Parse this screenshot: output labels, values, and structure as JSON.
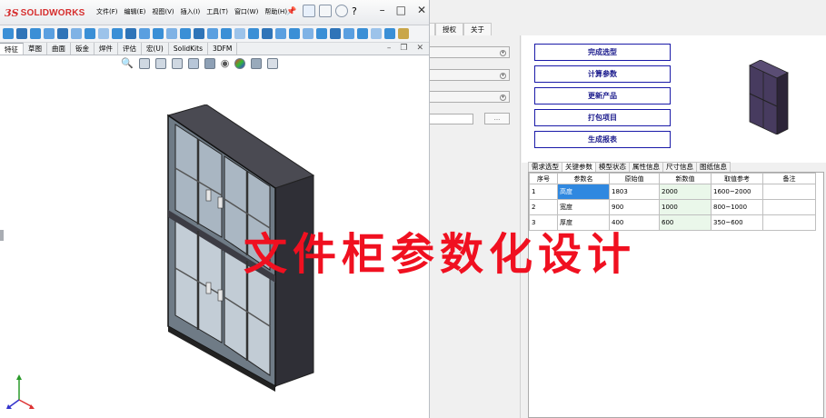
{
  "solidworks": {
    "logo_ds": "3S",
    "logo_text": "SOLIDWORKS",
    "menu": [
      "文件(F)",
      "编辑(E)",
      "视图(V)",
      "插入(I)",
      "工具(T)",
      "窗口(W)",
      "帮助(H)"
    ],
    "cmd_tabs": [
      {
        "label": "特征",
        "active": true
      },
      {
        "label": "草图"
      },
      {
        "label": "曲面"
      },
      {
        "label": "钣金"
      },
      {
        "label": "焊件"
      },
      {
        "label": "评估"
      },
      {
        "label": "宏(U)"
      },
      {
        "label": "SolidKits"
      },
      {
        "label": "3DFM"
      }
    ],
    "window_controls": [
      "–",
      "□",
      "✕"
    ]
  },
  "app": {
    "tabs": [
      "授权",
      "关于"
    ],
    "dots_label": "...",
    "actions": [
      "完成选型",
      "计算参数",
      "更新产品",
      "打包项目",
      "生成报表"
    ],
    "param_tabs": [
      {
        "label": "需求选型"
      },
      {
        "label": "关键参数",
        "active": true
      },
      {
        "label": "模型状态"
      },
      {
        "label": "属性信息"
      },
      {
        "label": "尺寸信息"
      },
      {
        "label": "图纸信息"
      }
    ],
    "table": {
      "headers": [
        "序号",
        "参数名",
        "原始值",
        "新数值",
        "取值参考",
        "备注"
      ],
      "rows": [
        [
          "1",
          "高度",
          "1803",
          "2000",
          "1600~2000",
          ""
        ],
        [
          "2",
          "宽度",
          "900",
          "1000",
          "800~1000",
          ""
        ],
        [
          "3",
          "厚度",
          "400",
          "600",
          "350~600",
          ""
        ]
      ]
    }
  },
  "overlay_title": "文件柜参数化设计",
  "colors": {
    "overlay": "#f01020",
    "button_border": "#1a1aa8",
    "selected_cell": "#2f88e0",
    "cabinet": "#3d3d44"
  }
}
